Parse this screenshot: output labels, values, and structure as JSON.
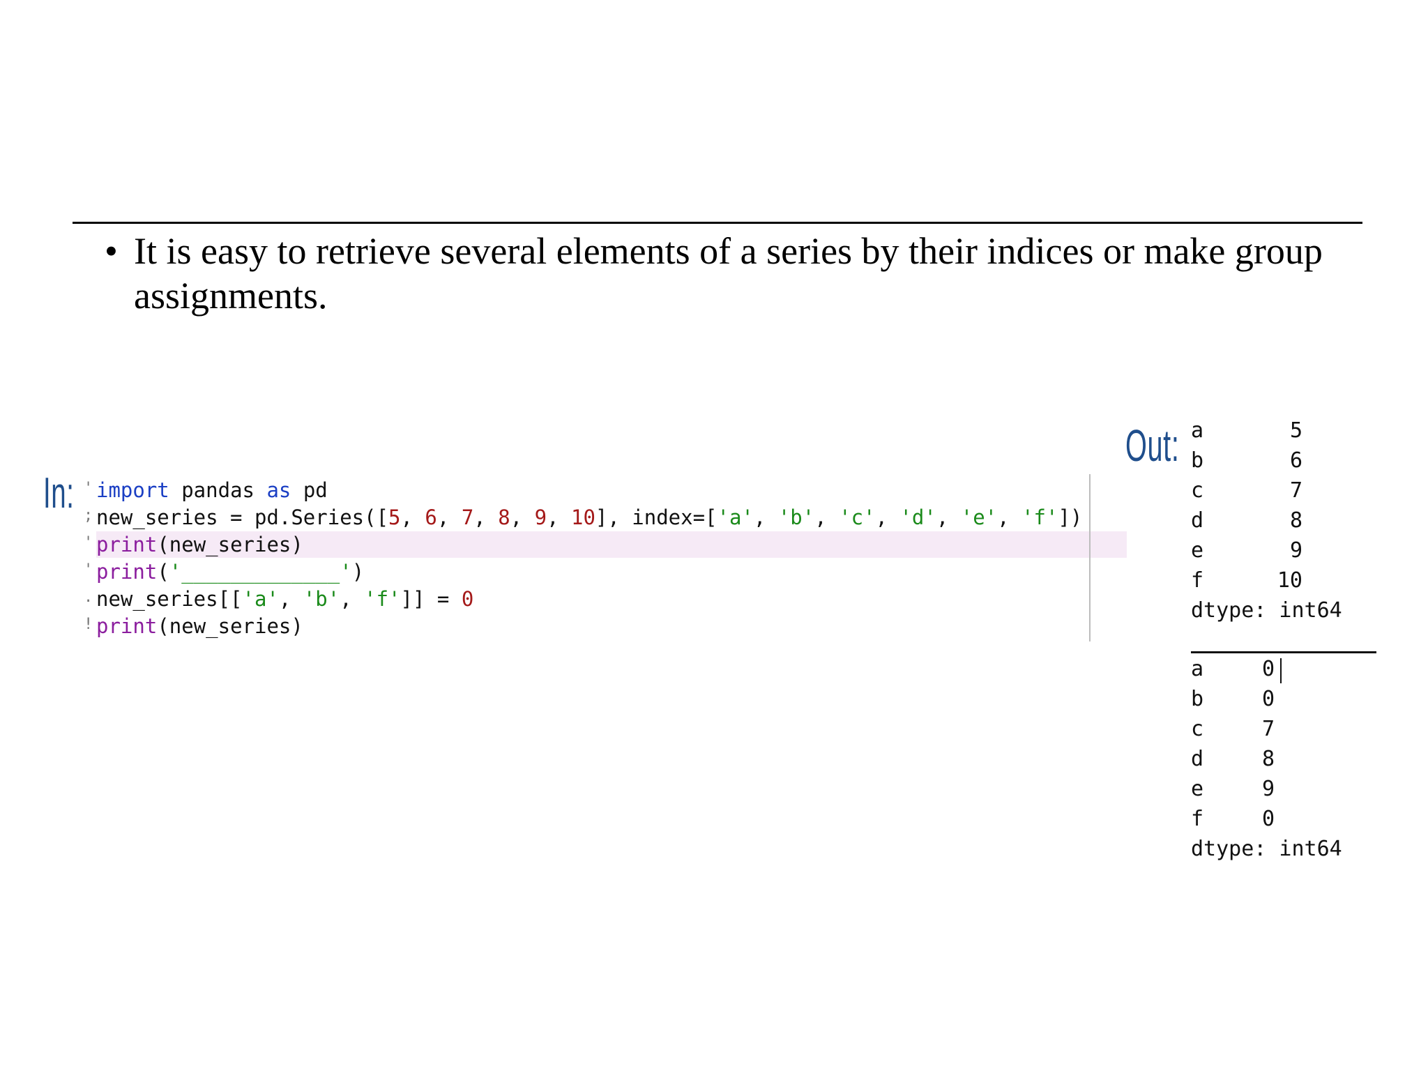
{
  "slide": {
    "bullet_symbol": "•",
    "bullet_text": "It is easy to retrieve several elements of a series by their indices or make group assignments."
  },
  "labels": {
    "in": "In:",
    "out": "Out:"
  },
  "code": {
    "gutter": [
      "'",
      ";",
      "'",
      "'",
      ".",
      "!"
    ],
    "lines": [
      [
        {
          "t": "import",
          "c": "kw"
        },
        {
          "t": " pandas ",
          "c": ""
        },
        {
          "t": "as",
          "c": "kw"
        },
        {
          "t": " pd",
          "c": ""
        }
      ],
      [
        {
          "t": "new_series = pd.Series([",
          "c": ""
        },
        {
          "t": "5",
          "c": "num"
        },
        {
          "t": ", ",
          "c": ""
        },
        {
          "t": "6",
          "c": "num"
        },
        {
          "t": ", ",
          "c": ""
        },
        {
          "t": "7",
          "c": "num"
        },
        {
          "t": ", ",
          "c": ""
        },
        {
          "t": "8",
          "c": "num"
        },
        {
          "t": ", ",
          "c": ""
        },
        {
          "t": "9",
          "c": "num"
        },
        {
          "t": ", ",
          "c": ""
        },
        {
          "t": "10",
          "c": "num"
        },
        {
          "t": "], index=[",
          "c": ""
        },
        {
          "t": "'a'",
          "c": "str"
        },
        {
          "t": ", ",
          "c": ""
        },
        {
          "t": "'b'",
          "c": "str"
        },
        {
          "t": ", ",
          "c": ""
        },
        {
          "t": "'c'",
          "c": "str"
        },
        {
          "t": ", ",
          "c": ""
        },
        {
          "t": "'d'",
          "c": "str"
        },
        {
          "t": ", ",
          "c": ""
        },
        {
          "t": "'e'",
          "c": "str"
        },
        {
          "t": ", ",
          "c": ""
        },
        {
          "t": "'f'",
          "c": "str"
        },
        {
          "t": "])",
          "c": ""
        }
      ],
      [
        {
          "t": "print",
          "c": "fn"
        },
        {
          "t": "(new_series)",
          "c": ""
        }
      ],
      [
        {
          "t": "print",
          "c": "fn"
        },
        {
          "t": "(",
          "c": ""
        },
        {
          "t": "'_____________'",
          "c": "str"
        },
        {
          "t": ")",
          "c": ""
        }
      ],
      [
        {
          "t": "new_series[[",
          "c": ""
        },
        {
          "t": "'a'",
          "c": "str"
        },
        {
          "t": ", ",
          "c": ""
        },
        {
          "t": "'b'",
          "c": "str"
        },
        {
          "t": ", ",
          "c": ""
        },
        {
          "t": "'f'",
          "c": "str"
        },
        {
          "t": "]] = ",
          "c": ""
        },
        {
          "t": "0",
          "c": "num"
        }
      ],
      [
        {
          "t": "print",
          "c": "fn"
        },
        {
          "t": "(new_series)",
          "c": ""
        }
      ]
    ]
  },
  "output": {
    "first": {
      "rows": [
        {
          "index": "a",
          "value": "5"
        },
        {
          "index": "b",
          "value": "6"
        },
        {
          "index": "c",
          "value": "7"
        },
        {
          "index": "d",
          "value": "8"
        },
        {
          "index": "e",
          "value": "9"
        },
        {
          "index": "f",
          "value": "10"
        }
      ],
      "dtype": "dtype: int64"
    },
    "second": {
      "rows": [
        {
          "index": "a",
          "value": "0"
        },
        {
          "index": "b",
          "value": "0"
        },
        {
          "index": "c",
          "value": "7"
        },
        {
          "index": "d",
          "value": "8"
        },
        {
          "index": "e",
          "value": "9"
        },
        {
          "index": "f",
          "value": "0"
        }
      ],
      "dtype": "dtype: int64"
    }
  },
  "colors": {
    "label_blue": "#1f4e8c",
    "keyword_blue": "#1b3fc4",
    "function_purple": "#8b1d9e",
    "number_red": "#a41919",
    "string_green": "#1a8a1a",
    "line_highlight": "#f6eaf6"
  }
}
